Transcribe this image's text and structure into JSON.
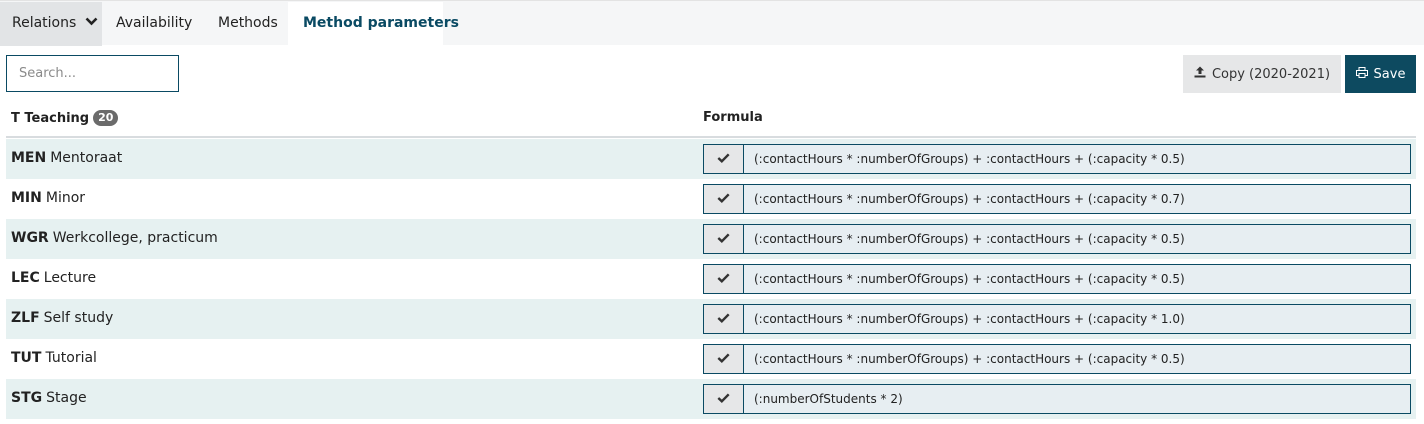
{
  "tabs": [
    {
      "label": "Relations"
    },
    {
      "label": "Availability"
    },
    {
      "label": "Methods"
    },
    {
      "label": "Method parameters"
    }
  ],
  "search": {
    "placeholder": "Search...",
    "value": ""
  },
  "toolbar": {
    "copy_label": "Copy (2020-2021)",
    "save_label": "Save"
  },
  "table": {
    "group_label": "T Teaching",
    "group_count": "20",
    "formula_header": "Formula",
    "rows": [
      {
        "code": "MEN",
        "name": "Mentoraat",
        "formula": "(:contactHours * :numberOfGroups) + :contactHours + (:capacity * 0.5)"
      },
      {
        "code": "MIN",
        "name": "Minor",
        "formula": "(:contactHours * :numberOfGroups) + :contactHours + (:capacity * 0.7)"
      },
      {
        "code": "WGR",
        "name": "Werkcollege, practicum",
        "formula": "(:contactHours * :numberOfGroups) + :contactHours + (:capacity * 0.5)"
      },
      {
        "code": "LEC",
        "name": "Lecture",
        "formula": "(:contactHours * :numberOfGroups) + :contactHours + (:capacity * 0.5)"
      },
      {
        "code": "ZLF",
        "name": "Self study",
        "formula": "(:contactHours * :numberOfGroups) + :contactHours + (:capacity * 1.0)"
      },
      {
        "code": "TUT",
        "name": "Tutorial",
        "formula": "(:contactHours * :numberOfGroups) + :contactHours + (:capacity * 0.5)"
      },
      {
        "code": "STG",
        "name": "Stage",
        "formula": "(:numberOfStudents * 2)"
      }
    ]
  },
  "colors": {
    "accent": "#0d4a60",
    "row_alt": "#e6f1f1",
    "formula_bg": "#e7eef2"
  },
  "icons": {
    "tab_relations": "chevron-down-icon",
    "copy": "upload-icon",
    "save": "printer-icon",
    "row_check": "checkmark-icon"
  }
}
